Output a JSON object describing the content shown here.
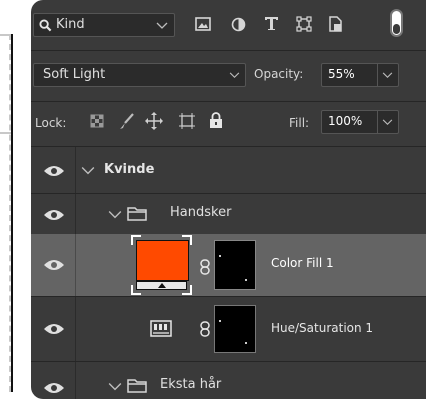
{
  "filter": {
    "icon": "search-icon",
    "label": "Kind"
  },
  "blend": {
    "mode": "Soft Light",
    "opacity_label": "Opacity:",
    "opacity_value": "55%"
  },
  "lock": {
    "label": "Lock:",
    "fill_label": "Fill:",
    "fill_value": "100%"
  },
  "layers": {
    "group_kvinde": "Kvinde",
    "group_handsker": "Handsker",
    "color_fill": "Color Fill 1",
    "hue_sat": "Hue/Saturation 1",
    "group_ekstra": "Eksta hår"
  },
  "colors": {
    "panel_bg": "#3a3a3a",
    "selected_row": "#646464",
    "fill_color": "#ff4a00"
  }
}
